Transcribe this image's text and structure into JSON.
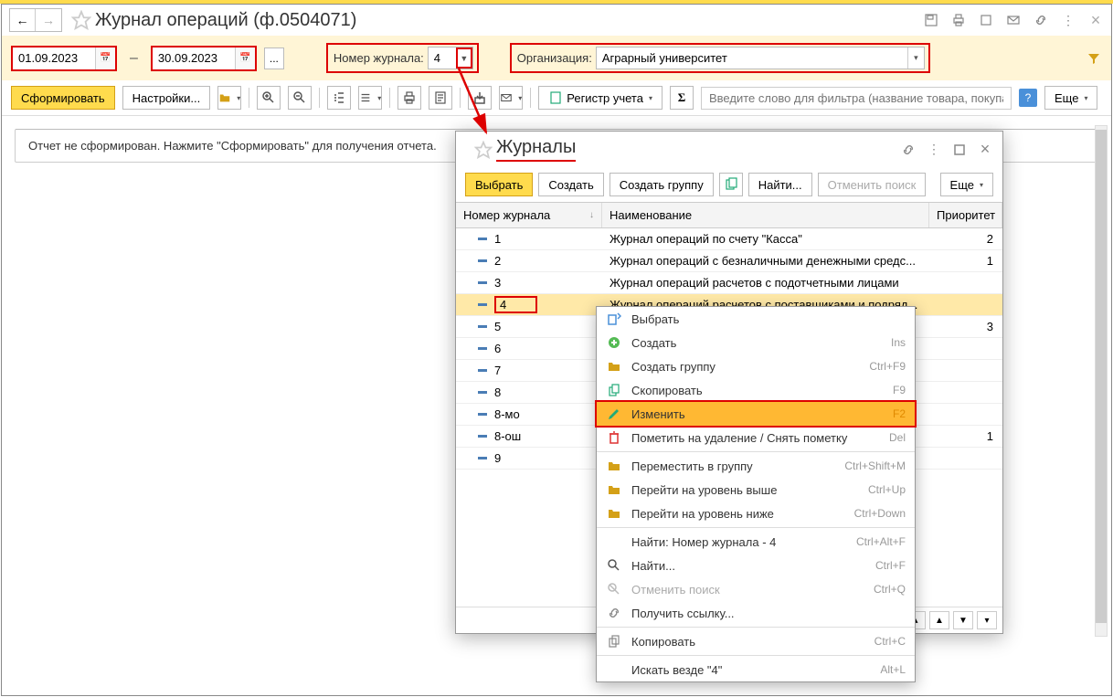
{
  "header": {
    "title": "Журнал операций (ф.0504071)"
  },
  "filter": {
    "date_from": "01.09.2023",
    "date_to": "30.09.2023",
    "journal_label": "Номер журнала:",
    "journal_value": "4",
    "org_label": "Организация:",
    "org_value": "Аграрный университет"
  },
  "toolbar": {
    "form": "Сформировать",
    "settings": "Настройки...",
    "register": "Регистр учета",
    "search_placeholder": "Введите слово для фильтра (название товара, покупателя и",
    "more": "Еще"
  },
  "report": {
    "empty_msg": "Отчет не сформирован. Нажмите \"Сформировать\" для получения отчета."
  },
  "popup": {
    "title": "Журналы",
    "btn_select": "Выбрать",
    "btn_create": "Создать",
    "btn_group": "Создать группу",
    "btn_find": "Найти...",
    "btn_cancel_search": "Отменить поиск",
    "btn_more": "Еще",
    "col_num": "Номер журнала",
    "col_name": "Наименование",
    "col_pri": "Приоритет",
    "rows": [
      {
        "num": "1",
        "name": "Журнал операций по счету \"Касса\"",
        "pri": "2"
      },
      {
        "num": "2",
        "name": "Журнал операций с безналичными денежными средс...",
        "pri": "1"
      },
      {
        "num": "3",
        "name": "Журнал операций расчетов с подотчетными лицами",
        "pri": ""
      },
      {
        "num": "4",
        "name": "Журнал операций расчетов с поставщиками и подряд...",
        "pri": ""
      },
      {
        "num": "5",
        "name": "",
        "pri": "3"
      },
      {
        "num": "6",
        "name": "",
        "pri": ""
      },
      {
        "num": "7",
        "name": "",
        "pri": ""
      },
      {
        "num": "8",
        "name": "",
        "pri": ""
      },
      {
        "num": "8-мо",
        "name": "",
        "pri": ""
      },
      {
        "num": "8-ош",
        "name": "",
        "pri": "1"
      },
      {
        "num": "9",
        "name": "",
        "pri": ""
      }
    ]
  },
  "ctx": {
    "select": {
      "label": "Выбрать",
      "sc": ""
    },
    "create": {
      "label": "Создать",
      "sc": "Ins"
    },
    "create_group": {
      "label": "Создать группу",
      "sc": "Ctrl+F9"
    },
    "copy": {
      "label": "Скопировать",
      "sc": "F9"
    },
    "edit": {
      "label": "Изменить",
      "sc": "F2"
    },
    "delete": {
      "label": "Пометить на удаление / Снять пометку",
      "sc": "Del"
    },
    "move_group": {
      "label": "Переместить в группу",
      "sc": "Ctrl+Shift+M"
    },
    "level_up": {
      "label": "Перейти на уровень выше",
      "sc": "Ctrl+Up"
    },
    "level_down": {
      "label": "Перейти на уровень ниже",
      "sc": "Ctrl+Down"
    },
    "find_num": {
      "label": "Найти: Номер журнала - 4",
      "sc": "Ctrl+Alt+F"
    },
    "find": {
      "label": "Найти...",
      "sc": "Ctrl+F"
    },
    "cancel_search": {
      "label": "Отменить поиск",
      "sc": "Ctrl+Q"
    },
    "get_link": {
      "label": "Получить ссылку...",
      "sc": ""
    },
    "copy_clip": {
      "label": "Копировать",
      "sc": "Ctrl+C"
    },
    "search_all": {
      "label": "Искать везде \"4\"",
      "sc": "Alt+L"
    }
  }
}
